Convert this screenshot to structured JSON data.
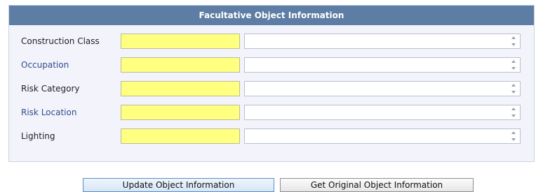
{
  "panel": {
    "title": "Facultative Object Information"
  },
  "fields": [
    {
      "label": "Construction Class",
      "is_link": false,
      "code_value": "",
      "description_value": ""
    },
    {
      "label": "Occupation",
      "is_link": true,
      "code_value": "",
      "description_value": ""
    },
    {
      "label": "Risk Category",
      "is_link": false,
      "code_value": "",
      "description_value": ""
    },
    {
      "label": "Risk Location",
      "is_link": true,
      "code_value": "",
      "description_value": ""
    },
    {
      "label": "Lighting",
      "is_link": false,
      "code_value": "",
      "description_value": ""
    }
  ],
  "buttons": {
    "update_label": "Update Object Information",
    "get_original_label": "Get Original Object Information"
  },
  "colors": {
    "header_bg": "#5e7da4",
    "panel_bg": "#f2f3fb",
    "code_field_bg": "#ffff80",
    "link_label": "#2f4f8f"
  }
}
